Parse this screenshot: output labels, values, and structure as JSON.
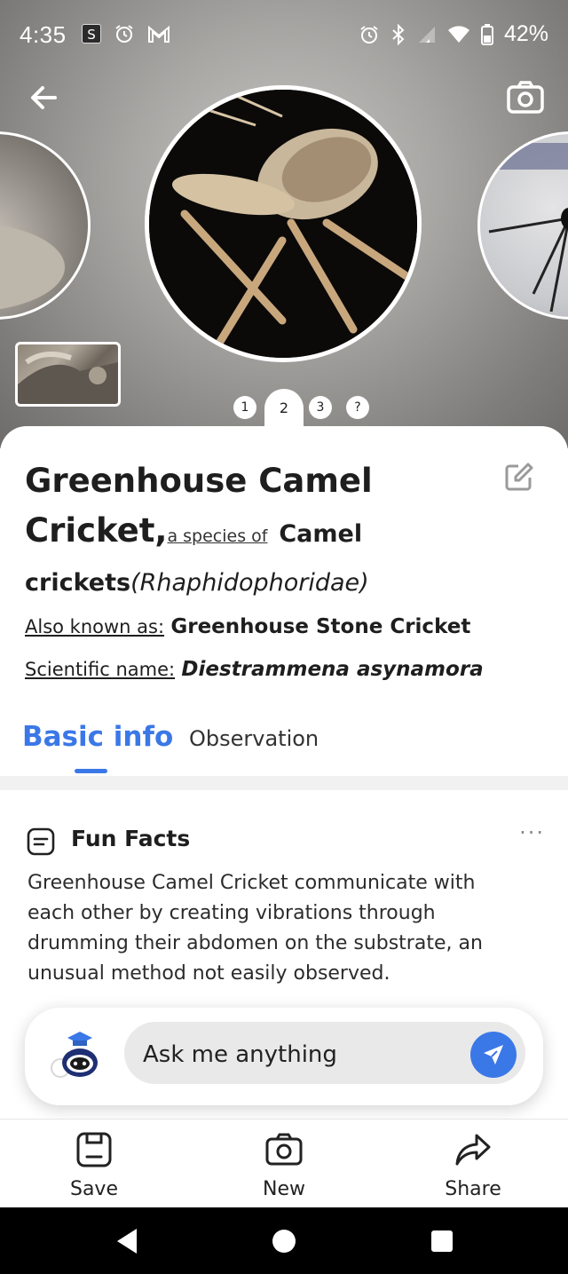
{
  "status_bar": {
    "time": "4:35",
    "left_icons": [
      "s-app-icon",
      "alarm-icon",
      "gmail-icon"
    ],
    "right_icons": [
      "alarm-icon",
      "bluetooth-icon",
      "signal-icon",
      "wifi-icon",
      "battery-icon"
    ],
    "battery": "42%"
  },
  "hero": {
    "back_icon": "arrow-left-icon",
    "camera_icon": "camera-icon",
    "pager": {
      "items": [
        "1",
        "2",
        "3",
        "?"
      ],
      "active": "2"
    }
  },
  "species": {
    "name_line1": "Greenhouse Camel",
    "name_line2": "Cricket,",
    "species_of_label": "a species of",
    "genus_part1": "Camel",
    "genus_part2": "crickets",
    "family": "(Rhaphidophoridae)",
    "also_known_label": "Also known as:",
    "also_known_value": "Greenhouse Stone Cricket",
    "scientific_label": "Scientific name:",
    "scientific_value": "Diestrammena asynamora"
  },
  "tabs": {
    "basic": "Basic info",
    "observation": "Observation",
    "active": "Basic info"
  },
  "fun_facts": {
    "title": "Fun Facts",
    "more": "···",
    "body": "Greenhouse Camel Cricket communicate with each other by creating vibrations through drumming their abdomen on the substrate, an unusual method not easily observed."
  },
  "chat": {
    "placeholder": "Ask me anything"
  },
  "actions": {
    "save": "Save",
    "new": "New",
    "share": "Share"
  },
  "colors": {
    "accent": "#3b78e7",
    "text": "#1e1e1e",
    "nav_bg": "#000000"
  }
}
